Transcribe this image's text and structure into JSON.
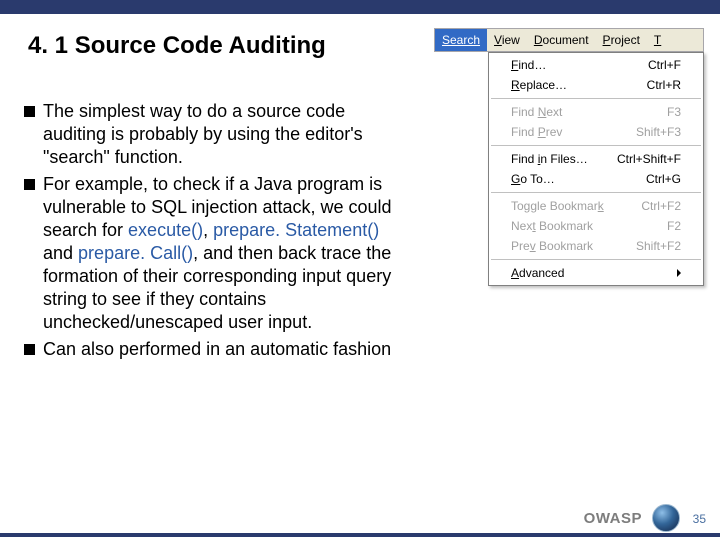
{
  "title": "4. 1 Source Code Auditing",
  "bullets": {
    "b1": "The simplest way to do a source code auditing is probably by using the editor's \"search\" function.",
    "b2_pre": "For example, to check if a Java program is vulnerable to SQL injection attack, we could search for ",
    "b2_h1": "execute()",
    "b2_s1": ", ",
    "b2_h2": "prepare. Statement()",
    "b2_s2": " and ",
    "b2_h3": "prepare. Call()",
    "b2_post": ", and then back trace the formation of their corresponding input query string to see if they contains unchecked/unescaped user input.",
    "b3": "Can also performed in an automatic fashion"
  },
  "menubar": {
    "items": {
      "search": "Search",
      "view": "View",
      "document": "Document",
      "project": "Project",
      "tools": "T"
    }
  },
  "menu": {
    "find": {
      "label": "Find…",
      "u": "F",
      "rest": "ind…",
      "sc": "Ctrl+F"
    },
    "replace": {
      "u": "R",
      "rest": "eplace…",
      "sc": "Ctrl+R"
    },
    "findnext": {
      "pre": "Find ",
      "u": "N",
      "rest": "ext",
      "sc": "F3"
    },
    "findprev": {
      "pre": "Find ",
      "u": "P",
      "rest": "rev",
      "sc": "Shift+F3"
    },
    "findinfiles": {
      "pre": "Find ",
      "u": "i",
      "rest": "n Files…",
      "sc": "Ctrl+Shift+F"
    },
    "goto": {
      "u": "G",
      "rest": "o To…",
      "sc": "Ctrl+G"
    },
    "toggle": {
      "pre": "Toggle Bookmar",
      "u": "k",
      "rest": "",
      "sc": "Ctrl+F2"
    },
    "nextbm": {
      "pre": "Nex",
      "u": "t",
      "rest": " Bookmark",
      "sc": "F2"
    },
    "prevbm": {
      "pre": "Pre",
      "u": "v",
      "rest": " Bookmark",
      "sc": "Shift+F2"
    },
    "adv": {
      "u": "A",
      "rest": "dvanced"
    }
  },
  "footer": {
    "owasp": "OWASP",
    "page": "35"
  }
}
